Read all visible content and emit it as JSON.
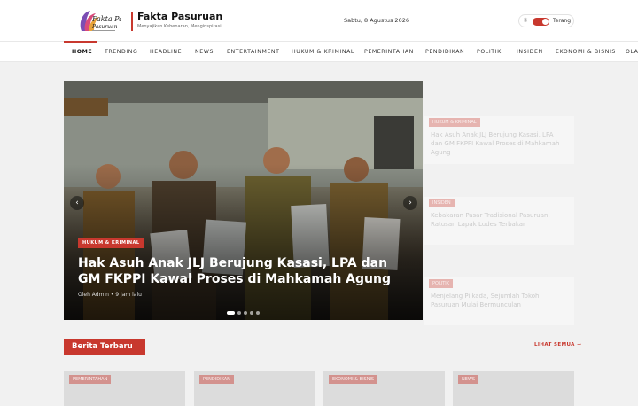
{
  "header": {
    "site_title": "Fakta Pasuruan",
    "tagline": "Menyajikan Kebenaran, Menginspirasi Perubahan",
    "logo_text": "Fakta Pasuruan",
    "date": "Sabtu, 8 Agustus 2026",
    "theme_label": "Terang",
    "theme_icon": "sun-icon",
    "accent_color": "#c8382e"
  },
  "nav": {
    "items": [
      "HOME",
      "TRENDING",
      "HEADLINE",
      "NEWS",
      "ENTERTAINMENT",
      "HUKUM & KRIMINAL",
      "PEMERINTAHAN",
      "PENDIDIKAN",
      "POLITIK",
      "INSIDEN",
      "EKONOMI & BISNIS",
      "OLAHRAGA"
    ],
    "active": "HOME"
  },
  "slider": {
    "category": "HUKUM & KRIMINAL",
    "title": "Hak Asuh Anak JLJ Berujung Kasasi, LPA dan GM FKPPI Kawal Proses di Mahkamah Agung",
    "author": "Oleh Admin",
    "time": "9 jam lalu",
    "slide_count": 5,
    "active_slide": 1,
    "prev_icon": "chevron-left-icon",
    "next_icon": "chevron-right-icon"
  },
  "side_cards": [
    {
      "category": "HUKUM & KRIMINAL",
      "title": "Hak Asuh Anak JLJ Berujung Kasasi, LPA dan GM FKPPI Kawal Proses di Mahkamah Agung"
    },
    {
      "category": "INSIDEN",
      "title": "Kebakaran Pasar Tradisional Pasuruan, Ratusan Lapak Ludes Terbakar"
    },
    {
      "category": "POLITIK",
      "title": "Menjelang Pilkada, Sejumlah Tokoh Pasuruan Mulai Bermunculan"
    }
  ],
  "latest": {
    "heading": "Berita Terbaru",
    "see_all": "LIHAT SEMUA →",
    "cards": [
      {
        "category": "PEMERINTAHAN"
      },
      {
        "category": "PENDIDIKAN"
      },
      {
        "category": "EKONOMI & BISNIS"
      },
      {
        "category": "NEWS"
      }
    ]
  }
}
